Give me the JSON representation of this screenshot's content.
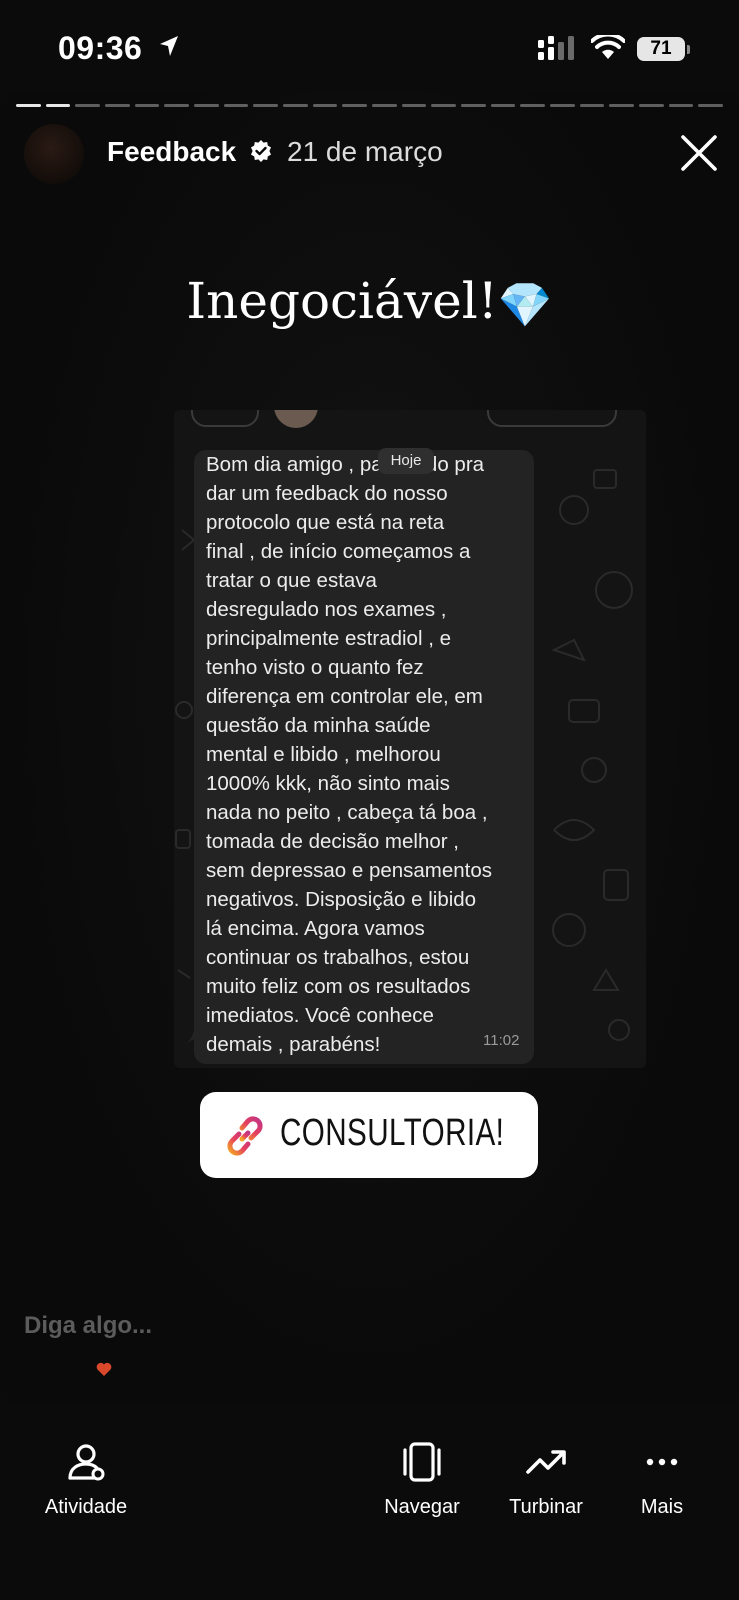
{
  "status_bar": {
    "time": "09:36",
    "battery": "71",
    "icons": [
      "location-arrow-icon",
      "cellular-signal-icon",
      "wifi-icon",
      "battery-icon"
    ]
  },
  "story": {
    "username": "Feedback",
    "date": "21 de março",
    "headline": "Inegociável!",
    "headline_emoji": "💎",
    "chat": {
      "message": "Bom dia amigo , passando pra\ndar um feedback do nosso\nprotocolo que está na reta\nfinal , de início começamos a\ntratar o que estava\ndesregulado nos exames ,\nprincipalmente estradiol , e\ntenho visto o quanto fez\ndiferença em controlar ele, em\nquestão da minha saúde\nmental e libido , melhorou\n1000% kkk, não sinto mais\nnada no peito , cabeça tá boa ,\ntomada de decisão melhor ,\nsem depressao e pensamentos\nnegativos. Disposição e libido\nlá encima. Agora vamos\ncontinuar os trabalhos, estou\nmuito feliz com os resultados\nimediatos. Você conhece\ndemais , parabéns!",
      "date_badge": "Hoje",
      "time": "11:02"
    },
    "link_sticker": {
      "label": "CONSULTORIA!",
      "icon": "link-icon"
    },
    "reply_placeholder": "Diga algo..."
  },
  "bottom_nav": [
    {
      "label": "Atividade",
      "icon": "activity-icon"
    },
    {
      "label": "Navegar",
      "icon": "navigate-icon"
    },
    {
      "label": "Turbinar",
      "icon": "trending-up-icon"
    },
    {
      "label": "Mais",
      "icon": "more-icon"
    }
  ],
  "colors": {
    "background": "#0b0b0c",
    "sticker_gradient_start": "#f5a623",
    "sticker_gradient_end": "#c13584",
    "verified": "#ffffff"
  }
}
